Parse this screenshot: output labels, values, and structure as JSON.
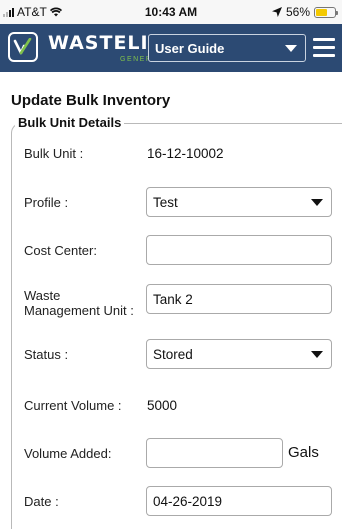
{
  "status_bar": {
    "carrier": "AT&T",
    "time": "10:43 AM",
    "battery": "56%",
    "battery_level": 0.56
  },
  "header": {
    "logo_text": "WASTELINQ",
    "logo_subtext": "GENERATOR",
    "guide_selected": "User Guide"
  },
  "page": {
    "title": "Update Bulk Inventory"
  },
  "bulk_unit_details": {
    "legend": "Bulk Unit Details",
    "bulk_unit": {
      "label": "Bulk Unit :",
      "value": "16-12-10002"
    },
    "profile": {
      "label": "Profile :",
      "value": "Test"
    },
    "cost_center": {
      "label": "Cost Center:",
      "value": ""
    },
    "waste_management_unit": {
      "label_line1": "Waste",
      "label_line2": "Management Unit :",
      "value": "Tank 2"
    },
    "status": {
      "label": "Status :",
      "value": "Stored"
    },
    "current_volume": {
      "label": "Current Volume :",
      "value": "5000"
    },
    "volume_added": {
      "label": "Volume Added:",
      "value": "",
      "unit": "Gals"
    },
    "date": {
      "label": "Date :",
      "value": "04-26-2019"
    }
  },
  "colors": {
    "header_bg": "#2c4a73",
    "logo_green": "#7fc14b",
    "battery": "#f4c900"
  }
}
